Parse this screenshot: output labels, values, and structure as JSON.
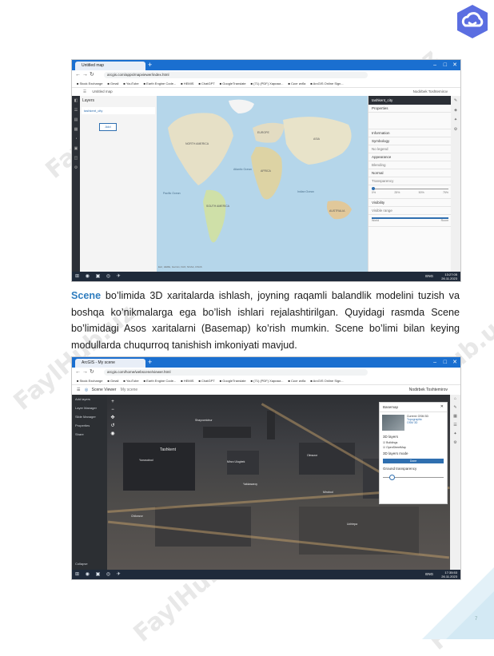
{
  "paragraph": {
    "scene_word": "Scene",
    "text": " bo’limida 3D xaritalarda ishlash, joyning raqamli balandlik modelini tuzish va boshqa ko’nikmalarga ega bo’lish ishlari rejalashtirilgan. Quyidagi rasmda Scene bo’limidagi Asos xaritalarni (Basemap) ko’rish mumkin. Scene bo’limi bilan keying modullarda chuqurroq tanishish imkoniyati mavjud."
  },
  "watermark": {
    "text": "FaylHub.uz"
  },
  "page_number": "7",
  "screenshot1": {
    "tab_title": "Untitled map",
    "url": "arcgis.com/apps/mapviewer/index.html",
    "bookmarks": [
      "Stock Exchange",
      "Gmail",
      "YouTube",
      "Earth Engine Code...",
      "HEMIS",
      "ChatGPT",
      "GoogleTranslate",
      "(71) (PDF) Харизм...",
      "Скот ихба",
      "ArcGIS Online Sign..."
    ],
    "app_title": "Untitled map",
    "user_name": "Nodirbek Toshtemirov",
    "layers_title": "Layers",
    "layer_item": "tashkent_city",
    "add_button": "Add",
    "props_title": "tashkent_city",
    "props_items": [
      "Properties",
      "Information",
      "Symbology",
      "No legend",
      "Appearance",
      "Blending",
      "Normal",
      "Transparency",
      "Visibility",
      "Visible range"
    ],
    "transparency_ticks": [
      "0%",
      "25%",
      "50%",
      "75%"
    ],
    "visible_range_labels": [
      "World",
      "Room"
    ],
    "map_labels": [
      "NORTH AMERICA",
      "SOUTH AMERICA",
      "EUROPE",
      "AFRICA",
      "ASIA",
      "AUSTRALIA",
      "Atlantic Ocean",
      "Pacific Ocean",
      "Indian Ocean"
    ],
    "map_attribution": "Esri, HERE, Garmin, FAO, NOAA, USGS",
    "taskbar_lang": "ENG",
    "clock_time": "13:27:05",
    "clock_date": "26.11.2023"
  },
  "screenshot2": {
    "tab_title": "ArcGIS - My scene",
    "url": "arcgis.com/home/webscene/viewer.html",
    "bookmarks": [
      "Stock Exchange",
      "Gmail",
      "YouTube",
      "Earth Engine Code...",
      "HEMIS",
      "ChatGPT",
      "GoogleTranslate",
      "(71) (PDF) Харизм...",
      "Скот ихба",
      "ArcGIS Online Sign..."
    ],
    "app_title": "Scene Viewer",
    "scene_name": "My scene",
    "user_name": "Nodirbek Toshtemirov",
    "side_items": [
      "Add layers",
      "Layer Manager",
      "Slide Manager",
      "Properties",
      "Share",
      "Collapse"
    ],
    "city_label": "Tashkent",
    "scene_labels": [
      "Yunusobod",
      "Mirzo Ulugbek",
      "Olmazor",
      "Chilonzor",
      "Yakkasaroy",
      "Mirobod",
      "Shayxontohur",
      "Uchtepa"
    ],
    "basemap_title": "Basemap",
    "basemap_items": [
      "Current: OSM 3D",
      "Topographic",
      "OSM 3D",
      "3D layers",
      "Buildings",
      "OpenStreetMap",
      "3D layers mode",
      "Done",
      "Ground transparency"
    ],
    "taskbar_lang": "ENG",
    "clock_time": "17:35:53",
    "clock_date": "26.11.2023"
  }
}
